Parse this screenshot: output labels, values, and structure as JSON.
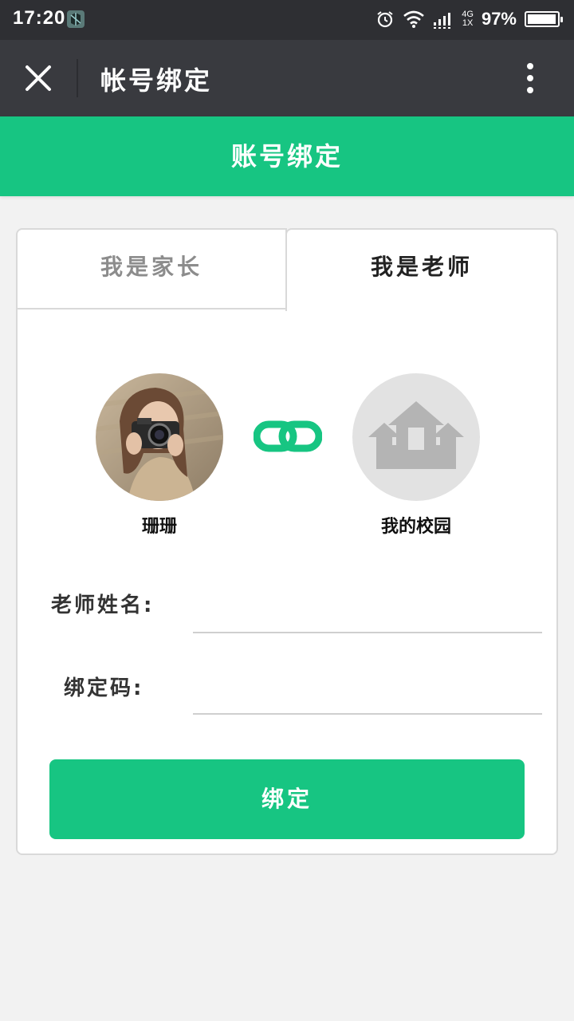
{
  "status_bar": {
    "time": "17:20",
    "network_type": "4G",
    "network_sub": "1X",
    "battery_percent": "97%",
    "battery_level": 0.97,
    "icons": [
      "app-notification-icon",
      "alarm-icon",
      "wifi-icon",
      "signal-icon",
      "battery-icon"
    ]
  },
  "title_bar": {
    "title": "帐号绑定",
    "close_icon": "close-icon",
    "more_icon": "more-vertical-icon"
  },
  "header": {
    "title": "账号绑定",
    "color": "#17c582"
  },
  "tabs": [
    {
      "label": "我是家长",
      "active": false
    },
    {
      "label": "我是老师",
      "active": true
    }
  ],
  "binding": {
    "user_name": "珊珊",
    "school_name": "我的校园",
    "link_icon": "link-icon",
    "school_icon": "castle-icon"
  },
  "form": {
    "teacher_name_label": "老师姓名:",
    "teacher_name_value": "",
    "bind_code_label": "绑定码:",
    "bind_code_value": "",
    "submit_label": "绑定"
  },
  "colors": {
    "accent": "#17c582",
    "status_bar": "#2e2f33",
    "title_bar": "#393a3f",
    "background": "#f2f2f2"
  }
}
